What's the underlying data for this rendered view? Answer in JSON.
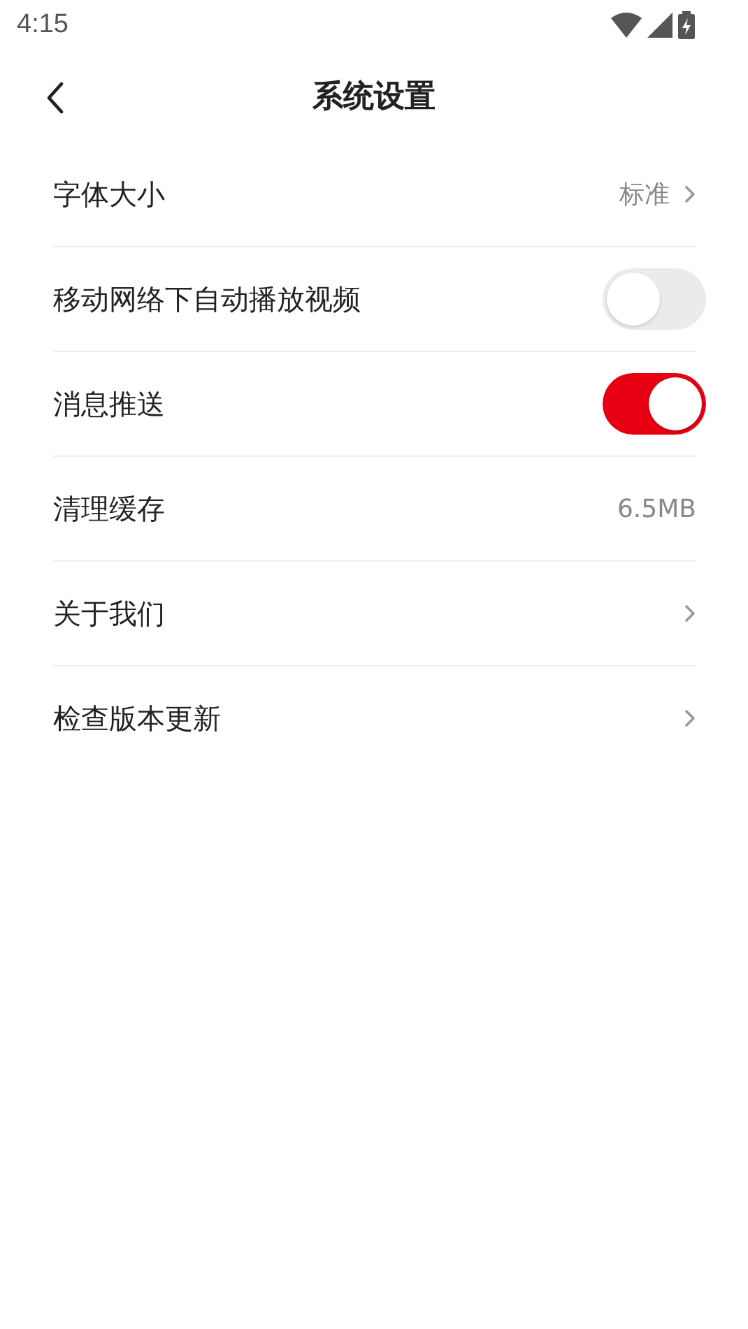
{
  "status_bar": {
    "time": "4:15"
  },
  "header": {
    "title": "系统设置"
  },
  "settings": [
    {
      "kind": "link",
      "label": "字体大小",
      "value": "标准"
    },
    {
      "kind": "toggle",
      "label": "移动网络下自动播放视频",
      "on": false
    },
    {
      "kind": "toggle",
      "label": "消息推送",
      "on": true
    },
    {
      "kind": "info",
      "label": "清理缓存",
      "value": "6.5MB"
    },
    {
      "kind": "link",
      "label": "关于我们"
    },
    {
      "kind": "link",
      "label": "检查版本更新"
    }
  ]
}
